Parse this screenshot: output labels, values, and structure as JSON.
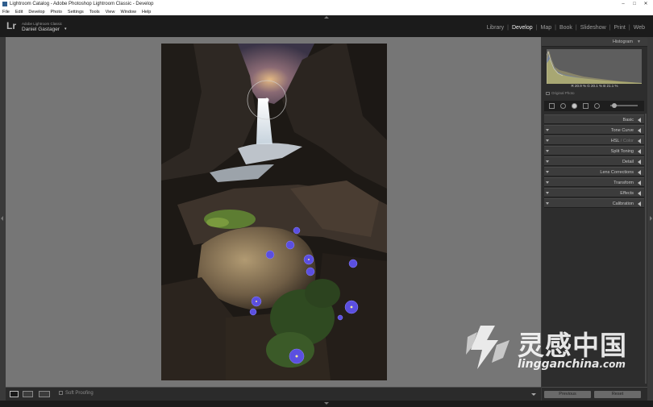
{
  "window": {
    "title": "Lightroom Catalog - Adobe Photoshop Lightroom Classic - Develop",
    "controls": [
      "–",
      "□",
      "✕"
    ]
  },
  "menubar": [
    "File",
    "Edit",
    "Develop",
    "Photo",
    "Settings",
    "Tools",
    "View",
    "Window",
    "Help"
  ],
  "identity": {
    "logo": "Lr",
    "line1": "Adobe Lightroom Classic",
    "line2": "Daniel Gastager"
  },
  "modules": {
    "items": [
      "Library",
      "Develop",
      "Map",
      "Book",
      "Slideshow",
      "Print",
      "Web"
    ],
    "active": "Develop"
  },
  "histogram": {
    "label": "Histogram",
    "values": "R  20.9  %  G  20.1  %  B  21.1  %",
    "original_photo": "Original Photo"
  },
  "panels": [
    {
      "label": "Basic"
    },
    {
      "label": "Tone Curve"
    },
    {
      "label_main": "HSL",
      "label_sep": " / ",
      "label_dim": "Color"
    },
    {
      "label": "Split Toning"
    },
    {
      "label": "Detail"
    },
    {
      "label": "Lens Corrections"
    },
    {
      "label": "Transform"
    },
    {
      "label": "Effects"
    },
    {
      "label": "Calibration"
    }
  ],
  "bottombar": {
    "soft_proofing": "Soft Proofing",
    "previous": "Previous",
    "reset": "Reset"
  },
  "watermark": {
    "chinese": "灵感中国",
    "url_main": "lingganchina",
    "url_tld": ".com"
  },
  "colors": {
    "accent_flowers": "#5b4fe0",
    "panel_bg": "#2d2d2d",
    "canvas_bg": "#767676"
  }
}
